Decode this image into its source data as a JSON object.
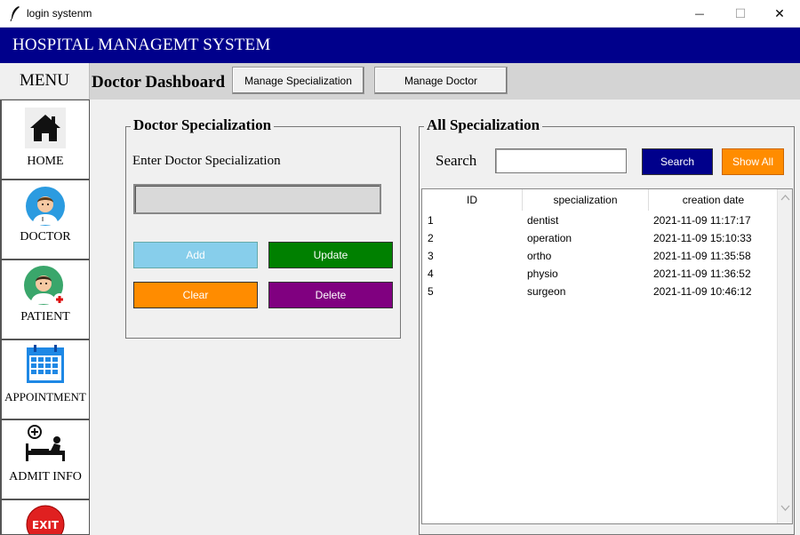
{
  "window": {
    "title": "login systenm",
    "minimize_glyph": "—",
    "maximize_glyph": "☐",
    "close_glyph": "✕"
  },
  "header": {
    "title": "HOSPITAL MANAGEMT SYSTEM",
    "bg_color": "#00008b"
  },
  "sidebar": {
    "menu_label": "MENU",
    "items": [
      {
        "label": "HOME",
        "icon": "home-icon"
      },
      {
        "label": "DOCTOR",
        "icon": "doctor-icon"
      },
      {
        "label": "PATIENT",
        "icon": "patient-icon"
      },
      {
        "label": "APPOINTMENT",
        "icon": "calendar-icon"
      },
      {
        "label": "ADMIT INFO",
        "icon": "hospital-bed-icon"
      },
      {
        "label": "EXIT",
        "icon": "exit-icon"
      }
    ]
  },
  "topbar": {
    "title": "Doctor Dashboard",
    "buttons": [
      "Manage Specialization",
      "Manage Doctor"
    ]
  },
  "specialization_form": {
    "group_title": "Doctor Specialization",
    "field_label": "Enter Doctor Specialization",
    "field_value": "",
    "buttons": {
      "add": {
        "label": "Add",
        "color": "#87ceeb"
      },
      "update": {
        "label": "Update",
        "color": "#008000"
      },
      "clear": {
        "label": "Clear",
        "color": "#ff8c00"
      },
      "delete": {
        "label": "Delete",
        "color": "#800080"
      }
    }
  },
  "all_specialization": {
    "group_title": "All Specialization",
    "search_label": "Search",
    "search_value": "",
    "search_button": {
      "label": "Search",
      "color": "#00008b"
    },
    "show_all_button": {
      "label": "Show All",
      "color": "#ff8c00"
    },
    "columns": [
      "ID",
      "specialization",
      "creation date"
    ],
    "rows": [
      {
        "id": "1",
        "specialization": "dentist",
        "date": "2021-11-09 11:17:17"
      },
      {
        "id": "2",
        "specialization": "operation",
        "date": "2021-11-09 15:10:33"
      },
      {
        "id": "3",
        "specialization": "ortho",
        "date": "2021-11-09 11:35:58"
      },
      {
        "id": "4",
        "specialization": "physio",
        "date": "2021-11-09 11:36:52"
      },
      {
        "id": "5",
        "specialization": "surgeon",
        "date": "2021-11-09 10:46:12"
      }
    ]
  }
}
